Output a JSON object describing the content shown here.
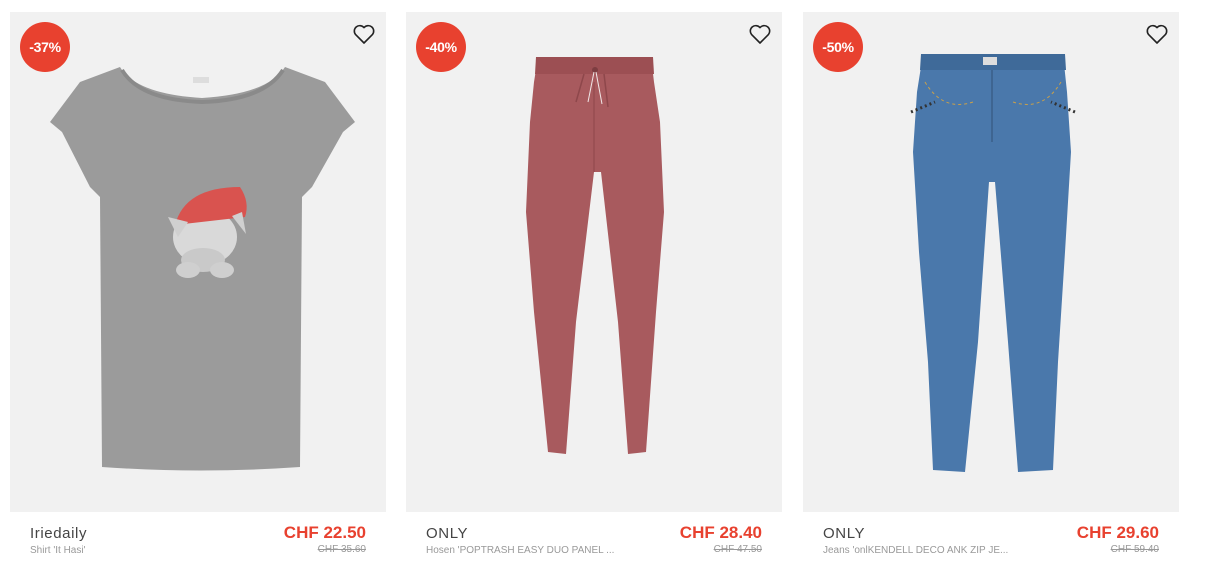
{
  "products": [
    {
      "discount": "-37%",
      "brand": "Iriedaily",
      "name": "Shirt 'It Hasi'",
      "price": "CHF 22.50",
      "old_price": "CHF 35.60",
      "icon": "tshirt-icon",
      "color": "#9a9a9a"
    },
    {
      "discount": "-40%",
      "brand": "ONLY",
      "name": "Hosen 'POPTRASH EASY DUO PANEL ...",
      "price": "CHF 28.40",
      "old_price": "CHF 47.50",
      "icon": "trousers-icon",
      "color": "#a85a5e"
    },
    {
      "discount": "-50%",
      "brand": "ONLY",
      "name": "Jeans 'onlKENDELL DECO ANK ZIP JE...",
      "price": "CHF 29.60",
      "old_price": "CHF 59.40",
      "icon": "jeans-icon",
      "color": "#4a78ab"
    }
  ],
  "wishlist_icon": "heart-outline-icon",
  "colors": {
    "sale_red": "#e8412f",
    "card_bg": "#f1f1f1"
  }
}
